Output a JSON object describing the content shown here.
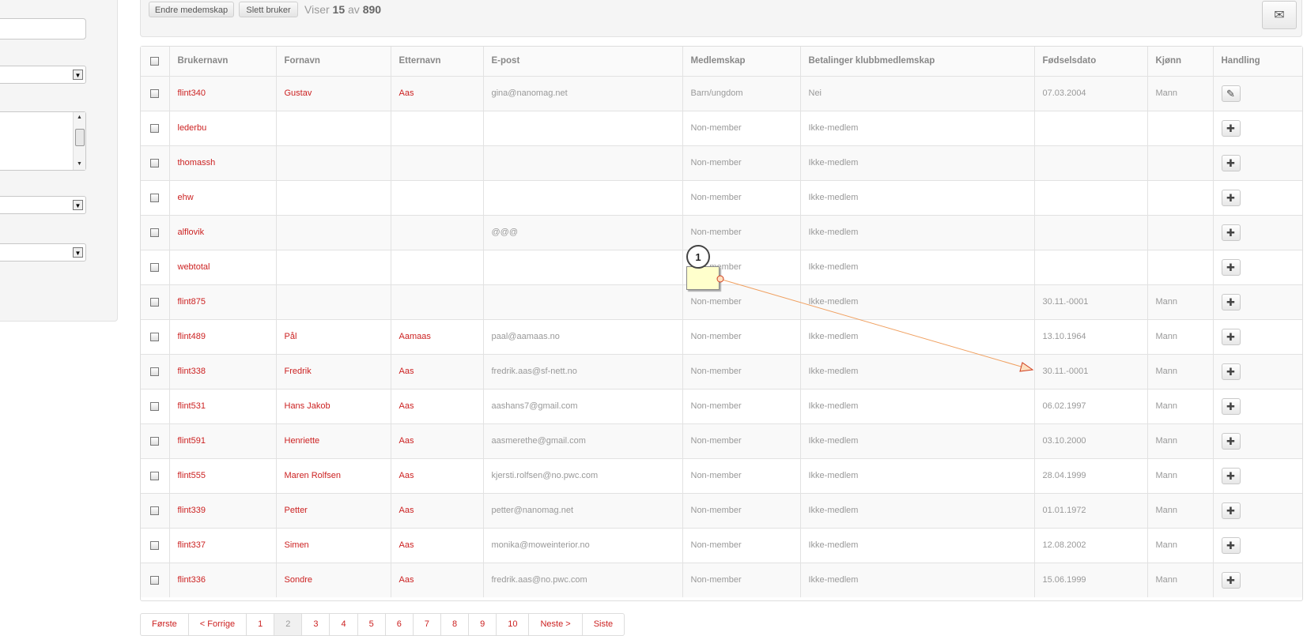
{
  "toolbar": {
    "change_membership": "Endre medemskap",
    "delete_user": "Slett bruker",
    "viewing_prefix": "Viser",
    "viewing_count": "15",
    "viewing_of": "av",
    "viewing_total": "890",
    "mail_icon": "✉"
  },
  "table": {
    "headers": {
      "username": "Brukernavn",
      "first_name": "Fornavn",
      "last_name": "Etternavn",
      "email": "E-post",
      "membership": "Medlemskap",
      "payments": "Betalinger klubbmedlemskap",
      "birthdate": "Fødselsdato",
      "gender": "Kjønn",
      "action": "Handling"
    },
    "rows": [
      {
        "username": "flint340",
        "first": "Gustav",
        "last": "Aas",
        "email": "gina@nanomag.net",
        "membership": "Barn/ungdom",
        "payment": "Nei",
        "birthdate": "07.03.2004",
        "gender": "Mann",
        "action": "edit"
      },
      {
        "username": "lederbu",
        "first": "",
        "last": "",
        "email": "",
        "membership": "Non-member",
        "payment": "Ikke-medlem",
        "birthdate": "",
        "gender": "",
        "action": "add"
      },
      {
        "username": "thomassh",
        "first": "",
        "last": "",
        "email": "",
        "membership": "Non-member",
        "payment": "Ikke-medlem",
        "birthdate": "",
        "gender": "",
        "action": "add"
      },
      {
        "username": "ehw",
        "first": "",
        "last": "",
        "email": "",
        "membership": "Non-member",
        "payment": "Ikke-medlem",
        "birthdate": "",
        "gender": "",
        "action": "add"
      },
      {
        "username": "alflovik",
        "first": "",
        "last": "",
        "email": "@@@",
        "membership": "Non-member",
        "payment": "Ikke-medlem",
        "birthdate": "",
        "gender": "",
        "action": "add"
      },
      {
        "username": "webtotal",
        "first": "",
        "last": "",
        "email": "",
        "membership": "Non-member",
        "payment": "Ikke-medlem",
        "birthdate": "",
        "gender": "",
        "action": "add"
      },
      {
        "username": "flint875",
        "first": "",
        "last": "",
        "email": "",
        "membership": "Non-member",
        "payment": "Ikke-medlem",
        "birthdate": "30.11.-0001",
        "gender": "Mann",
        "action": "add"
      },
      {
        "username": "flint489",
        "first": "Pål",
        "last": "Aamaas",
        "email": "paal@aamaas.no",
        "membership": "Non-member",
        "payment": "Ikke-medlem",
        "birthdate": "13.10.1964",
        "gender": "Mann",
        "action": "add"
      },
      {
        "username": "flint338",
        "first": "Fredrik",
        "last": "Aas",
        "email": "fredrik.aas@sf-nett.no",
        "membership": "Non-member",
        "payment": "Ikke-medlem",
        "birthdate": "30.11.-0001",
        "gender": "Mann",
        "action": "add"
      },
      {
        "username": "flint531",
        "first": "Hans Jakob",
        "last": "Aas",
        "email": "aashans7@gmail.com",
        "membership": "Non-member",
        "payment": "Ikke-medlem",
        "birthdate": "06.02.1997",
        "gender": "Mann",
        "action": "add"
      },
      {
        "username": "flint591",
        "first": "Henriette",
        "last": "Aas",
        "email": "aasmerethe@gmail.com",
        "membership": "Non-member",
        "payment": "Ikke-medlem",
        "birthdate": "03.10.2000",
        "gender": "Mann",
        "action": "add"
      },
      {
        "username": "flint555",
        "first": "Maren Rolfsen",
        "last": "Aas",
        "email": "kjersti.rolfsen@no.pwc.com",
        "membership": "Non-member",
        "payment": "Ikke-medlem",
        "birthdate": "28.04.1999",
        "gender": "Mann",
        "action": "add"
      },
      {
        "username": "flint339",
        "first": "Petter",
        "last": "Aas",
        "email": "petter@nanomag.net",
        "membership": "Non-member",
        "payment": "Ikke-medlem",
        "birthdate": "01.01.1972",
        "gender": "Mann",
        "action": "add"
      },
      {
        "username": "flint337",
        "first": "Simen",
        "last": "Aas",
        "email": "monika@moweinterior.no",
        "membership": "Non-member",
        "payment": "Ikke-medlem",
        "birthdate": "12.08.2002",
        "gender": "Mann",
        "action": "add"
      },
      {
        "username": "flint336",
        "first": "Sondre",
        "last": "Aas",
        "email": "fredrik.aas@no.pwc.com",
        "membership": "Non-member",
        "payment": "Ikke-medlem",
        "birthdate": "15.06.1999",
        "gender": "Mann",
        "action": "add"
      }
    ]
  },
  "icons": {
    "edit": "✎",
    "add": "✚",
    "dropdown": "▼",
    "scroll_up": "▲",
    "scroll_down": "▼"
  },
  "pagination": [
    {
      "label": "Første"
    },
    {
      "label": "< Forrige"
    },
    {
      "label": "1"
    },
    {
      "label": "2",
      "active": true
    },
    {
      "label": "3"
    },
    {
      "label": "4"
    },
    {
      "label": "5"
    },
    {
      "label": "6"
    },
    {
      "label": "7"
    },
    {
      "label": "8"
    },
    {
      "label": "9"
    },
    {
      "label": "10"
    },
    {
      "label": "Neste >"
    },
    {
      "label": "Siste"
    }
  ],
  "annotation": {
    "badge": "1"
  },
  "colors": {
    "link": "#cc2222",
    "annotation_line": "#f0a060",
    "note_bg": "#ffffcc"
  }
}
